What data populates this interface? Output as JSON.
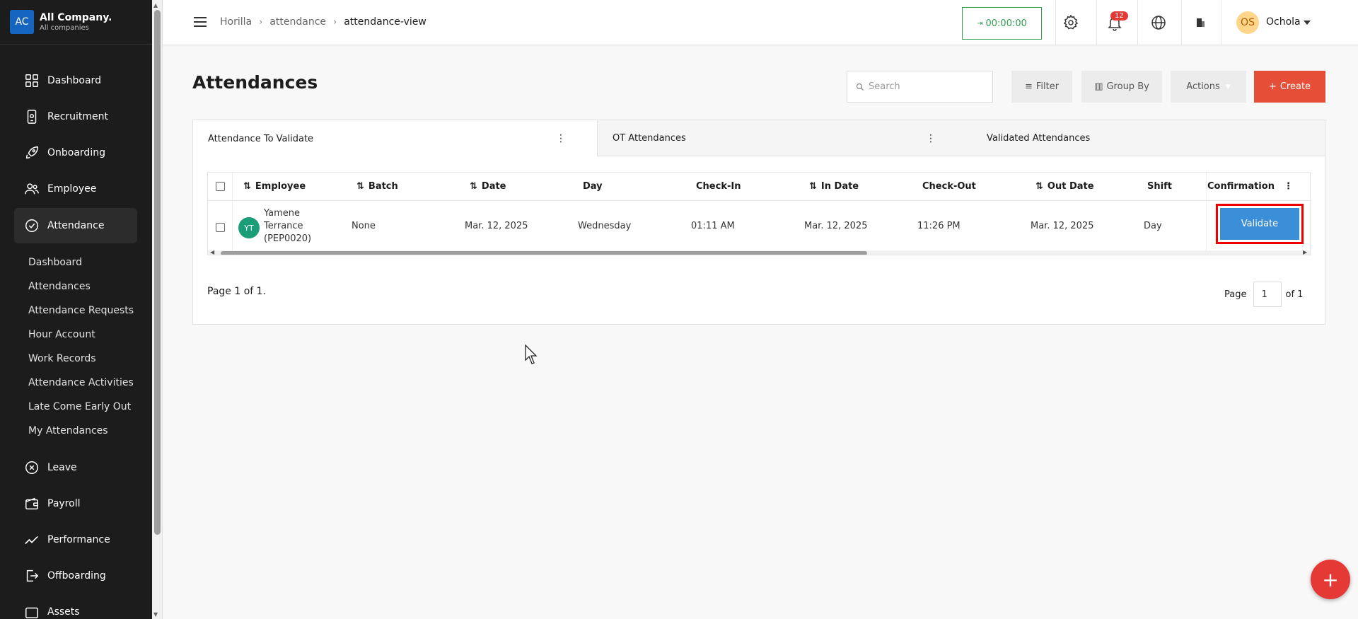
{
  "company": {
    "logo": "AC",
    "name": "All Company.",
    "subtitle": "All companies"
  },
  "sidebar": {
    "items": [
      {
        "label": "Dashboard",
        "icon": "dashboard-grid-icon"
      },
      {
        "label": "Recruitment",
        "icon": "phone-badge-icon"
      },
      {
        "label": "Onboarding",
        "icon": "rocket-icon"
      },
      {
        "label": "Employee",
        "icon": "users-icon"
      },
      {
        "label": "Attendance",
        "icon": "check-circle-icon",
        "active": true
      },
      {
        "label": "Leave",
        "icon": "close-circle-icon"
      },
      {
        "label": "Payroll",
        "icon": "wallet-icon"
      },
      {
        "label": "Performance",
        "icon": "trend-line-icon"
      },
      {
        "label": "Offboarding",
        "icon": "exit-icon"
      },
      {
        "label": "Assets",
        "icon": "box-icon"
      }
    ],
    "attendance_submenu": [
      "Dashboard",
      "Attendances",
      "Attendance Requests",
      "Hour Account",
      "Work Records",
      "Attendance Activities",
      "Late Come Early Out",
      "My Attendances"
    ]
  },
  "topbar": {
    "breadcrumb": [
      "Horilla",
      "attendance",
      "attendance-view"
    ],
    "timer": "00:00:00",
    "notification_count": "12",
    "user_initials": "OS",
    "user_name": "Ochola"
  },
  "page": {
    "title": "Attendances",
    "search_placeholder": "Search",
    "filter_label": "Filter",
    "group_by_label": "Group By",
    "actions_label": "Actions",
    "create_label": "Create"
  },
  "tabs": [
    "Attendance To Validate",
    "OT Attendances",
    "Validated Attendances"
  ],
  "table": {
    "headers": {
      "employee": "Employee",
      "batch": "Batch",
      "date": "Date",
      "day": "Day",
      "check_in": "Check-In",
      "in_date": "In Date",
      "check_out": "Check-Out",
      "out_date": "Out Date",
      "shift": "Shift",
      "confirmation": "Confirmation"
    },
    "rows": [
      {
        "initials": "YT",
        "employee_line1": "Yamene",
        "employee_line2": "Terrance",
        "employee_line3": "(PEP0020)",
        "batch": "None",
        "date": "Mar. 12, 2025",
        "day": "Wednesday",
        "check_in": "01:11 AM",
        "in_date": "Mar. 12, 2025",
        "check_out": "11:26 PM",
        "out_date": "Mar. 12, 2025",
        "shift": "Day",
        "action": "Validate"
      }
    ]
  },
  "pagination": {
    "info": "Page 1 of 1.",
    "page_label": "Page",
    "current_page": "1",
    "of_label": "of 1"
  },
  "colors": {
    "sidebar_bg": "#1c1c1c",
    "create_button": "#e54f38",
    "validate_button": "#3b8fd9",
    "timer_green": "#2e9e4f",
    "highlight_border": "#ee0000"
  }
}
